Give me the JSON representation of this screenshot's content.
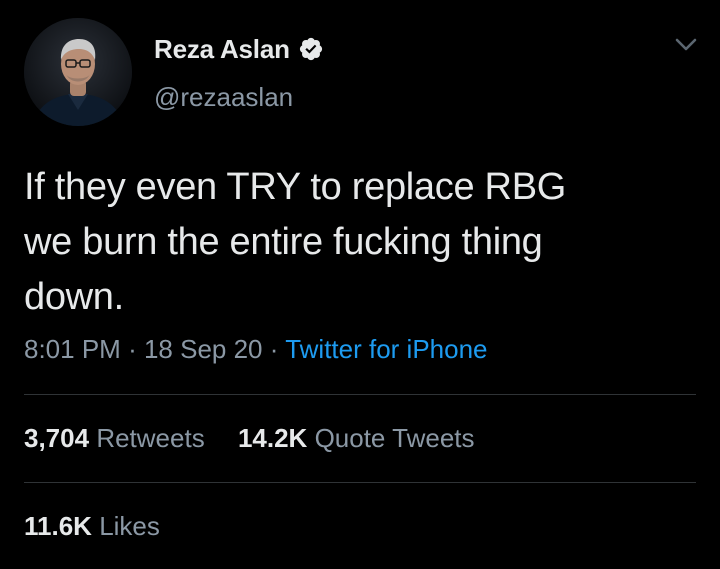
{
  "tweet": {
    "author": {
      "display_name": "Reza Aslan",
      "handle": "@rezaaslan",
      "verified": true,
      "verified_icon": "verified-badge-icon",
      "avatar": "profile-photo"
    },
    "menu_icon": "chevron-down-icon",
    "text_lines": [
      "If they even TRY to replace RBG",
      "we burn the entire fucking thing",
      "down."
    ],
    "time": "8:01 PM",
    "date": "18 Sep 20",
    "separator": "·",
    "source": "Twitter for iPhone",
    "stats": {
      "retweets_count": "3,704",
      "retweets_label": "Retweets",
      "quotes_count": "14.2K",
      "quotes_label": "Quote Tweets",
      "likes_count": "11.6K",
      "likes_label": "Likes"
    }
  },
  "colors": {
    "background": "#000000",
    "primary_text": "#e7e9ea",
    "secondary_text": "#8b98a5",
    "link": "#1d9bf0",
    "divider": "#2f3336"
  }
}
